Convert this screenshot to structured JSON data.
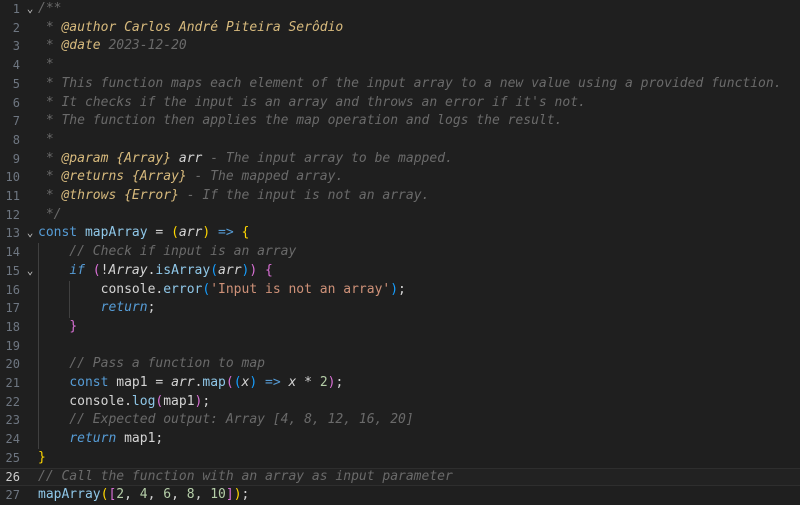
{
  "editor": {
    "language": "javascript",
    "current_line": 26,
    "lines": [
      {
        "n": 1,
        "fold": "open",
        "tokens": [
          {
            "t": "/**",
            "c": "com"
          }
        ]
      },
      {
        "n": 2,
        "tokens": [
          {
            "t": " * ",
            "c": "com"
          },
          {
            "t": "@author",
            "c": "tag"
          },
          {
            "t": " Carlos André Piteira Serôdio",
            "c": "tag"
          }
        ]
      },
      {
        "n": 3,
        "tokens": [
          {
            "t": " * ",
            "c": "com"
          },
          {
            "t": "@date",
            "c": "tag"
          },
          {
            "t": " 2023-12-20",
            "c": "com"
          }
        ]
      },
      {
        "n": 4,
        "tokens": [
          {
            "t": " *",
            "c": "com"
          }
        ]
      },
      {
        "n": 5,
        "tokens": [
          {
            "t": " * This function maps each element of the input array to a new value using a provided function.",
            "c": "com"
          }
        ]
      },
      {
        "n": 6,
        "tokens": [
          {
            "t": " * It checks if the input is an array and throws an error if it's not.",
            "c": "com"
          }
        ]
      },
      {
        "n": 7,
        "tokens": [
          {
            "t": " * The function then applies the map operation and logs the result.",
            "c": "com"
          }
        ]
      },
      {
        "n": 8,
        "tokens": [
          {
            "t": " *",
            "c": "com"
          }
        ]
      },
      {
        "n": 9,
        "tokens": [
          {
            "t": " * ",
            "c": "com"
          },
          {
            "t": "@param",
            "c": "tag"
          },
          {
            "t": " ",
            "c": "com"
          },
          {
            "t": "{Array}",
            "c": "type"
          },
          {
            "t": " ",
            "c": "com"
          },
          {
            "t": "arr",
            "c": "param"
          },
          {
            "t": " - The input array to be mapped.",
            "c": "com"
          }
        ]
      },
      {
        "n": 10,
        "tokens": [
          {
            "t": " * ",
            "c": "com"
          },
          {
            "t": "@returns",
            "c": "tag"
          },
          {
            "t": " ",
            "c": "com"
          },
          {
            "t": "{Array}",
            "c": "type"
          },
          {
            "t": " - The mapped array.",
            "c": "com"
          }
        ]
      },
      {
        "n": 11,
        "tokens": [
          {
            "t": " * ",
            "c": "com"
          },
          {
            "t": "@throws",
            "c": "tag"
          },
          {
            "t": " ",
            "c": "com"
          },
          {
            "t": "{Error}",
            "c": "type"
          },
          {
            "t": " - If the input is not an array.",
            "c": "com"
          }
        ]
      },
      {
        "n": 12,
        "tokens": [
          {
            "t": " */",
            "c": "com"
          }
        ]
      },
      {
        "n": 13,
        "fold": "open",
        "tokens": [
          {
            "t": "const",
            "c": "kw"
          },
          {
            "t": " ",
            "c": "op"
          },
          {
            "t": "mapArray",
            "c": "fn"
          },
          {
            "t": " = ",
            "c": "op"
          },
          {
            "t": "(",
            "c": "b1"
          },
          {
            "t": "arr",
            "c": "ital"
          },
          {
            "t": ")",
            "c": "b1"
          },
          {
            "t": " ",
            "c": "op"
          },
          {
            "t": "=>",
            "c": "kw"
          },
          {
            "t": " ",
            "c": "op"
          },
          {
            "t": "{",
            "c": "b1"
          }
        ]
      },
      {
        "n": 14,
        "tokens": [
          {
            "t": "    // Check if input is an array",
            "c": "com"
          }
        ]
      },
      {
        "n": 15,
        "fold": "open",
        "tokens": [
          {
            "t": "    ",
            "c": "op"
          },
          {
            "t": "if",
            "c": "ctrl"
          },
          {
            "t": " ",
            "c": "op"
          },
          {
            "t": "(",
            "c": "b2"
          },
          {
            "t": "!",
            "c": "op"
          },
          {
            "t": "Array",
            "c": "ital"
          },
          {
            "t": ".",
            "c": "op"
          },
          {
            "t": "isArray",
            "c": "fn"
          },
          {
            "t": "(",
            "c": "b3"
          },
          {
            "t": "arr",
            "c": "ital"
          },
          {
            "t": ")",
            "c": "b3"
          },
          {
            "t": ")",
            "c": "b2"
          },
          {
            "t": " ",
            "c": "op"
          },
          {
            "t": "{",
            "c": "b2"
          }
        ]
      },
      {
        "n": 16,
        "tokens": [
          {
            "t": "        console.",
            "c": "var"
          },
          {
            "t": "error",
            "c": "fn"
          },
          {
            "t": "(",
            "c": "b3"
          },
          {
            "t": "'Input is not an array'",
            "c": "str"
          },
          {
            "t": ")",
            "c": "b3"
          },
          {
            "t": ";",
            "c": "op"
          }
        ]
      },
      {
        "n": 17,
        "tokens": [
          {
            "t": "        ",
            "c": "op"
          },
          {
            "t": "return",
            "c": "ctrl"
          },
          {
            "t": ";",
            "c": "op"
          }
        ]
      },
      {
        "n": 18,
        "tokens": [
          {
            "t": "    ",
            "c": "op"
          },
          {
            "t": "}",
            "c": "b2"
          }
        ]
      },
      {
        "n": 19,
        "tokens": []
      },
      {
        "n": 20,
        "tokens": [
          {
            "t": "    // Pass a function to map",
            "c": "com"
          }
        ]
      },
      {
        "n": 21,
        "tokens": [
          {
            "t": "    ",
            "c": "op"
          },
          {
            "t": "const",
            "c": "kw"
          },
          {
            "t": " map1 = ",
            "c": "var"
          },
          {
            "t": "arr",
            "c": "ital"
          },
          {
            "t": ".",
            "c": "op"
          },
          {
            "t": "map",
            "c": "fn"
          },
          {
            "t": "(",
            "c": "b2"
          },
          {
            "t": "(",
            "c": "b3"
          },
          {
            "t": "x",
            "c": "ital"
          },
          {
            "t": ")",
            "c": "b3"
          },
          {
            "t": " ",
            "c": "op"
          },
          {
            "t": "=>",
            "c": "kw"
          },
          {
            "t": " ",
            "c": "op"
          },
          {
            "t": "x",
            "c": "ital"
          },
          {
            "t": " * ",
            "c": "op"
          },
          {
            "t": "2",
            "c": "num"
          },
          {
            "t": ")",
            "c": "b2"
          },
          {
            "t": ";",
            "c": "op"
          }
        ]
      },
      {
        "n": 22,
        "tokens": [
          {
            "t": "    console.",
            "c": "var"
          },
          {
            "t": "log",
            "c": "fn"
          },
          {
            "t": "(",
            "c": "b2"
          },
          {
            "t": "map1",
            "c": "var"
          },
          {
            "t": ")",
            "c": "b2"
          },
          {
            "t": ";",
            "c": "op"
          }
        ]
      },
      {
        "n": 23,
        "tokens": [
          {
            "t": "    // Expected output: Array [4, 8, 12, 16, 20]",
            "c": "com"
          }
        ]
      },
      {
        "n": 24,
        "tokens": [
          {
            "t": "    ",
            "c": "op"
          },
          {
            "t": "return",
            "c": "ctrl"
          },
          {
            "t": " map1;",
            "c": "var"
          }
        ]
      },
      {
        "n": 25,
        "tokens": [
          {
            "t": "}",
            "c": "b1"
          }
        ]
      },
      {
        "n": 26,
        "tokens": [
          {
            "t": "// Call the function with an array as input parameter",
            "c": "com"
          }
        ]
      },
      {
        "n": 27,
        "tokens": [
          {
            "t": "mapArray",
            "c": "fn"
          },
          {
            "t": "(",
            "c": "b1"
          },
          {
            "t": "[",
            "c": "b2"
          },
          {
            "t": "2",
            "c": "num"
          },
          {
            "t": ", ",
            "c": "op"
          },
          {
            "t": "4",
            "c": "num"
          },
          {
            "t": ", ",
            "c": "op"
          },
          {
            "t": "6",
            "c": "num"
          },
          {
            "t": ", ",
            "c": "op"
          },
          {
            "t": "8",
            "c": "num"
          },
          {
            "t": ", ",
            "c": "op"
          },
          {
            "t": "10",
            "c": "num"
          },
          {
            "t": "]",
            "c": "b2"
          },
          {
            "t": ")",
            "c": "b1"
          },
          {
            "t": ";",
            "c": "op"
          }
        ]
      }
    ]
  }
}
